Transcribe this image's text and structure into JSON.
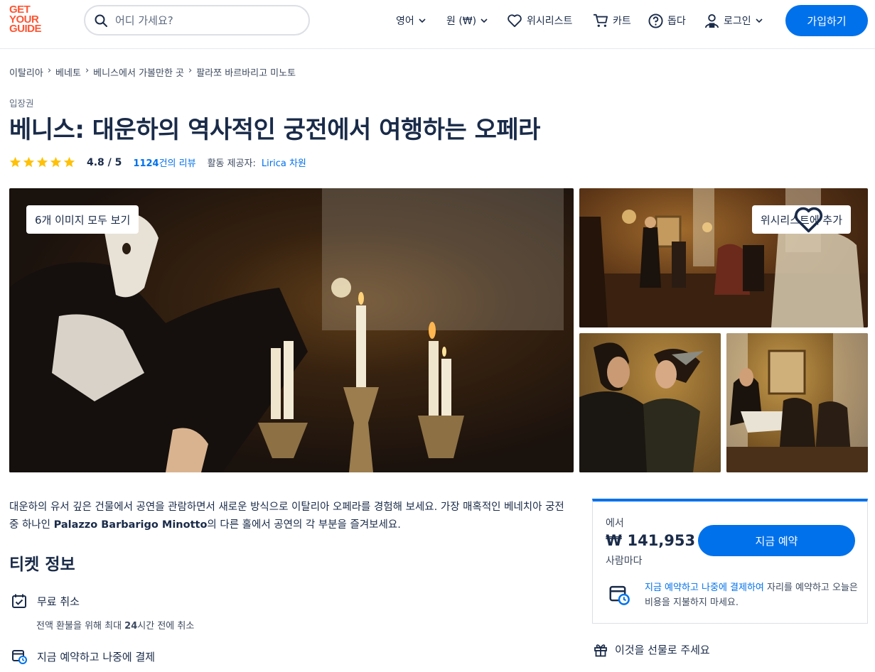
{
  "brand": {
    "logo_lines": [
      "GET",
      "YOUR",
      "GUIDE"
    ],
    "accent": "#ff5533",
    "primary": "#0071eb"
  },
  "search": {
    "placeholder": "어디 가세요?",
    "icon": "search-icon"
  },
  "nav": {
    "language": "영어",
    "currency": "원 (₩)",
    "wishlist": "위시리스트",
    "cart": "카트",
    "help": "돕다",
    "login": "로그인",
    "signup": "가입하기"
  },
  "breadcrumb": [
    "이탈리아",
    "베네토",
    "베니스에서 가볼만한 곳",
    "팔라쪼 바르바리고 미노토"
  ],
  "category": "입장권",
  "title": "베니스: 대운하의 역사적인 궁전에서 여행하는 오페라",
  "rating": {
    "stars": 5,
    "score": "4.8 / 5",
    "review_count": "1124",
    "review_suffix": "건의 리뷰",
    "provider_label": "활동 제공자:",
    "provider": "Lirica 차원"
  },
  "gallery": {
    "view_all": "6개 이미지 모두 보기",
    "wishlist_add": "위시리스트에 추가"
  },
  "description": {
    "part1": "대운하의 유서 깊은 건물에서 공연을 관람하면서 새로운 방식으로 이탈리아 오페라를 경험해 보세요. 가장 매혹적인 베네치아 궁전 중 하나인 ",
    "bold": "Palazzo Barbarigo Minotto",
    "part2": "의 다른 홀에서 공연의 각 부분을 즐겨보세요."
  },
  "ticket_info": {
    "title": "티켓 정보",
    "free_cancel": "무료 취소",
    "free_cancel_sub_pre": "전액 환불을 위해 최대 ",
    "free_cancel_sub_bold": "24",
    "free_cancel_sub_post": "시간 전에 취소",
    "reserve_later": "지금 예약하고 나중에 결제"
  },
  "booking": {
    "from": "에서",
    "price": "₩ 141,953",
    "per": "사람마다",
    "button": "지금 예약",
    "note_highlight": "지금 예약하고 나중에 결제하여",
    "note_rest": " 자리를 예약하고 오늘은 비용을 지불하지 마세요."
  },
  "gift": "이것을 선물로 주세요"
}
